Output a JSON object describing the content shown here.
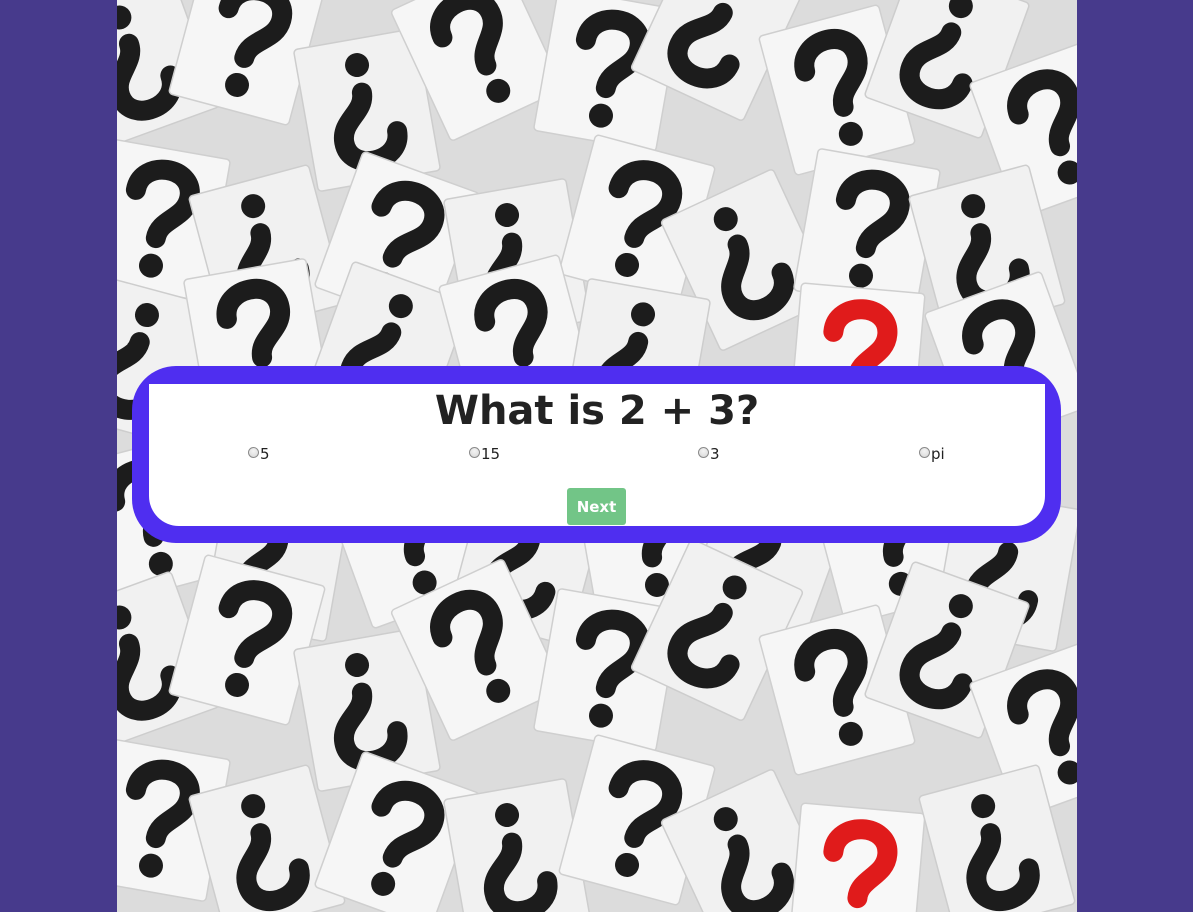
{
  "quiz": {
    "question": "What is 2 + 3?",
    "options": [
      {
        "label": "5"
      },
      {
        "label": "15"
      },
      {
        "label": "3"
      },
      {
        "label": "pi"
      }
    ],
    "next_label": "Next"
  },
  "colors": {
    "page_background": "#473a8c",
    "frame": "#4f2ef0",
    "card": "#ffffff",
    "next_button": "#72c587",
    "accent_question_mark": "#e01b1b"
  },
  "background_image": {
    "icon": "question-mark-cards-pattern"
  }
}
